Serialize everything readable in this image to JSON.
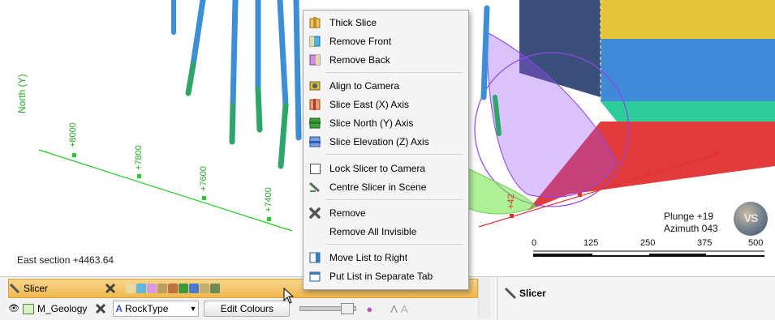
{
  "scene": {
    "axis_title": "North (Y)",
    "northing_ticks": [
      "+8000",
      "+7800",
      "+7600",
      "+7400"
    ],
    "red_axis_tick": "+42",
    "section_label": "East section +4463.64",
    "plunge": "Plunge +19",
    "azimuth": "Azimuth 043",
    "scale_labels": [
      "0",
      "125",
      "250",
      "375",
      "500"
    ],
    "compass_text": "VS",
    "colors": {
      "grid_line": "#22cc22",
      "red_axis": "#e23030",
      "drill_blue": "#3c8fd6",
      "drill_green": "#2ea66a",
      "wireframe": "#9a4cf0"
    }
  },
  "context_menu": {
    "items": [
      {
        "label": "Thick Slice",
        "icon": "thick-slice-icon",
        "group": 1
      },
      {
        "label": "Remove Front",
        "icon": "remove-front-icon",
        "group": 1
      },
      {
        "label": "Remove Back",
        "icon": "remove-back-icon",
        "group": 1
      },
      {
        "label": "Align to Camera",
        "icon": "align-camera-icon",
        "group": 2
      },
      {
        "label": "Slice East (X) Axis",
        "icon": "slice-east-icon",
        "group": 2
      },
      {
        "label": "Slice North (Y) Axis",
        "icon": "slice-north-icon",
        "group": 2
      },
      {
        "label": "Slice Elevation (Z) Axis",
        "icon": "slice-elevation-icon",
        "group": 2
      },
      {
        "label": "Lock Slicer to Camera",
        "icon": "checkbox-icon",
        "group": 3
      },
      {
        "label": "Centre Slicer in Scene",
        "icon": "centre-slicer-icon",
        "group": 3
      },
      {
        "label": "Remove",
        "icon": "remove-x-icon",
        "group": 4
      },
      {
        "label": "Remove All Invisible",
        "icon": "",
        "group": 4
      },
      {
        "label": "Move List to Right",
        "icon": "move-list-icon",
        "group": 5
      },
      {
        "label": "Put List in Separate Tab",
        "icon": "separate-tab-icon",
        "group": 5
      }
    ]
  },
  "shape_list": {
    "slicer_row": {
      "label": "Slicer"
    },
    "geology_row": {
      "label": "M_Geology",
      "colour_by": "RockType",
      "edit_button": "Edit Colours"
    }
  },
  "properties_panel": {
    "title": "Slicer"
  }
}
